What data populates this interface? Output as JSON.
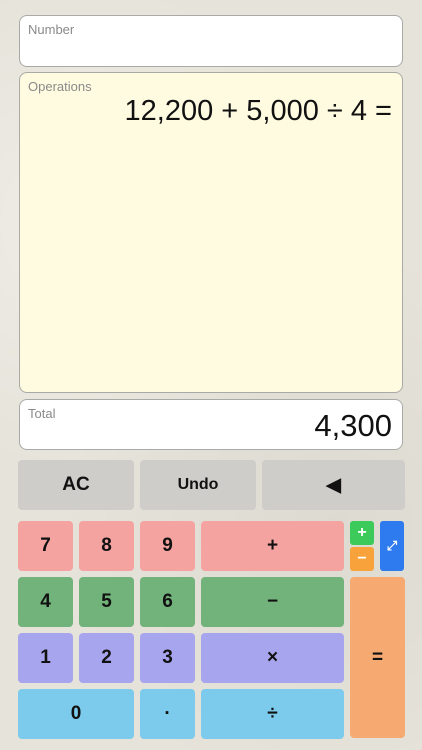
{
  "number_field": {
    "label": "Number",
    "value": ""
  },
  "operations_field": {
    "label": "Operations",
    "expression": "12,200 + 5,000 ÷ 4 ="
  },
  "total_field": {
    "label": "Total",
    "value": "4,300"
  },
  "keys": {
    "ac": "AC",
    "undo": "Undo",
    "backspace": "◀",
    "seven": "7",
    "eight": "8",
    "nine": "9",
    "plus": "+",
    "four": "4",
    "five": "5",
    "six": "6",
    "minus": "−",
    "one": "1",
    "two": "2",
    "three": "3",
    "times": "×",
    "zero": "0",
    "dot": "·",
    "divide": "÷",
    "equals": "=",
    "mini_plus": "+",
    "mini_minus": "−",
    "expand": "⤢"
  },
  "colors": {
    "gray": "#cfcdc9",
    "red": "#f4a3a1",
    "green": "#72b37b",
    "purple": "#a8a5ef",
    "blue": "#7ccbec",
    "orange": "#f6a970",
    "mini_green": "#3ccb5a",
    "mini_orange": "#f7a23a",
    "mini_blue": "#2e7bf0"
  }
}
